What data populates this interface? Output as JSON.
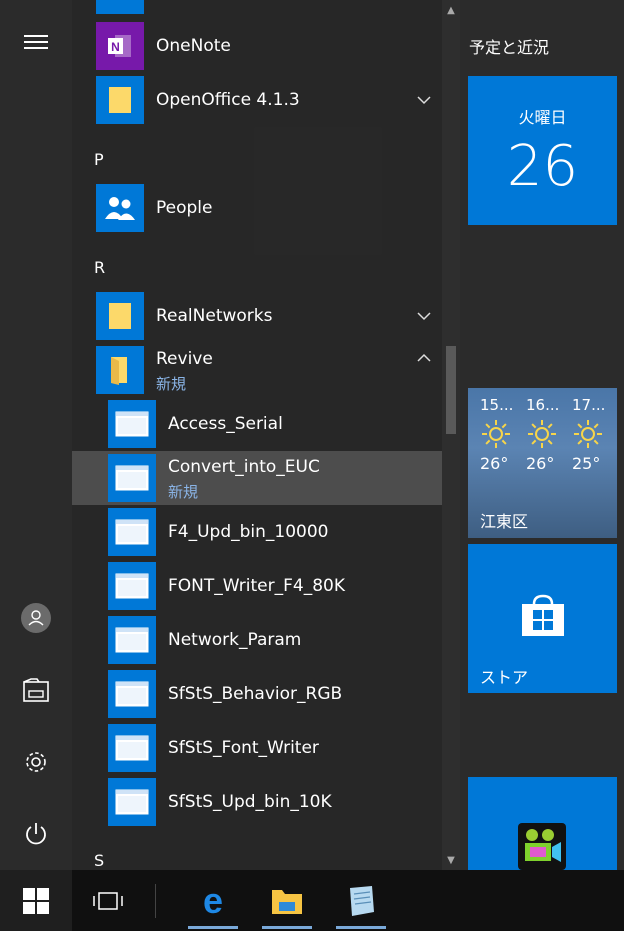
{
  "sections": {
    "p": "P",
    "r": "R",
    "s": "S"
  },
  "apps": {
    "onenote": "OneNote",
    "openoffice": "OpenOffice 4.1.3",
    "people": "People",
    "realnetworks": "RealNetworks",
    "revive": "Revive",
    "revive_badge": "新規",
    "revive_items": [
      {
        "label": "Access_Serial"
      },
      {
        "label": "Convert_into_EUC",
        "badge": "新規"
      },
      {
        "label": "F4_Upd_bin_10000"
      },
      {
        "label": "FONT_Writer_F4_80K"
      },
      {
        "label": "Network_Param"
      },
      {
        "label": "SfStS_Behavior_RGB"
      },
      {
        "label": "SfStS_Font_Writer"
      },
      {
        "label": "SfStS_Upd_bin_10K"
      }
    ]
  },
  "tiles": {
    "group_title": "予定と近況",
    "calendar": {
      "day_name": "火曜日",
      "day_number": "26"
    },
    "weather": {
      "days": [
        {
          "date": "15...",
          "temp": "26°"
        },
        {
          "date": "16...",
          "temp": "26°"
        },
        {
          "date": "17...",
          "temp": "25°"
        }
      ],
      "location": "江東区"
    },
    "store": {
      "label": "ストア"
    }
  },
  "colors": {
    "accent": "#0078d7",
    "selected_row": "#4d4d4d",
    "badge": "#8ab4e6"
  },
  "icons": {
    "rail": [
      "hamburger-icon",
      "user-icon",
      "documents-icon",
      "settings-icon",
      "power-icon"
    ],
    "taskbar": [
      "windows-logo-icon",
      "task-view-icon",
      "edge-icon",
      "file-explorer-icon",
      "notepad-icon"
    ]
  }
}
